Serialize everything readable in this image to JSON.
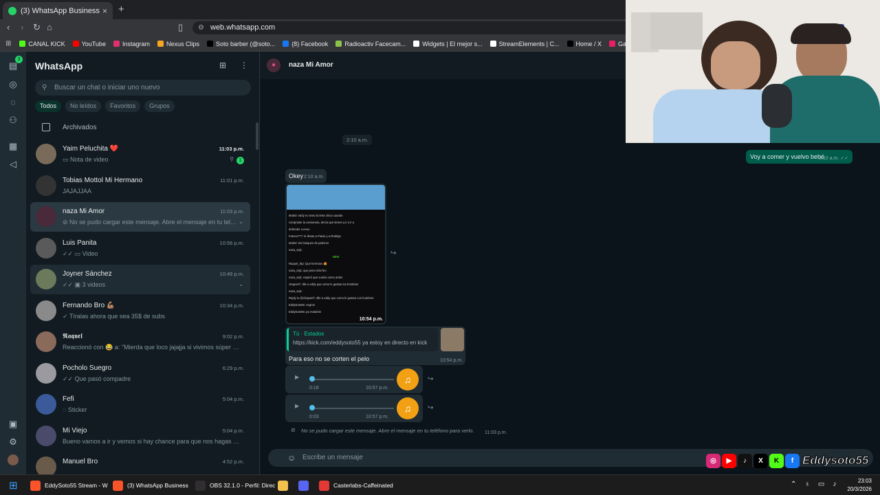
{
  "browser": {
    "tab_title": "(3) WhatsApp Business",
    "tab_close": "×",
    "new_tab": "+",
    "url": "web.whatsapp.com",
    "bookmarks": [
      {
        "label": "CANAL KICK",
        "color": "#53fc18"
      },
      {
        "label": "YouTube",
        "color": "#ff0000"
      },
      {
        "label": "Instagram",
        "color": "#e1306c"
      },
      {
        "label": "Nexus Clips",
        "color": "#f5a623"
      },
      {
        "label": "Soto barber (@soto...",
        "color": "#000000"
      },
      {
        "label": "(8) Facebook",
        "color": "#1877f2"
      },
      {
        "label": "Radioactiv Facecam...",
        "color": "#8bc34a"
      },
      {
        "label": "Widgets | El mejor s...",
        "color": "#ffffff"
      },
      {
        "label": "StreamElements | C...",
        "color": "#ffffff"
      },
      {
        "label": "Home / X",
        "color": "#000000"
      },
      {
        "label": "Gartic Phone - Tele...",
        "color": "#e91e63"
      }
    ]
  },
  "rail": {
    "badge": "3"
  },
  "sidebar": {
    "title": "WhatsApp",
    "search_placeholder": "Buscar un chat o iniciar uno nuevo",
    "filters": [
      "Todos",
      "No leídos",
      "Favoritos",
      "Grupos"
    ],
    "archived_label": "Archivados",
    "chats": [
      {
        "name": "Yaim Peluchita ❤️",
        "time": "11:03 p.m.",
        "preview": "▭ Nota de video",
        "unread": "1",
        "avatar": "#7a6a5a"
      },
      {
        "name": "Tobias Mottol Mi Hermano",
        "time": "11:01 p.m.",
        "preview": "JAJAJJAA",
        "avatar": "#333333"
      },
      {
        "name": "naza Mi Amor",
        "time": "11:03 p.m.",
        "preview": "⊘ No se pudo cargar este mensaje. Abre el mensaje en tu teléfono para verlo.",
        "avatar": "#4a2a3a"
      },
      {
        "name": "Luis Panita",
        "time": "10:56 p.m.",
        "preview": "✓✓ ▭ Video",
        "avatar": "#5a5a5a"
      },
      {
        "name": "Joyner Sánchez",
        "time": "10:49 p.m.",
        "preview": "✓✓ ▣ 3 videos",
        "avatar": "#6a7a5a"
      },
      {
        "name": "Fernando Bro 💪🏽",
        "time": "10:34 p.m.",
        "preview": "✓ Tíralas ahora que sea 35$ de subs",
        "avatar": "#8a8a8a"
      },
      {
        "name": "𝕽𝖆𝖖𝖚𝖊𝖑",
        "time": "9:02 p.m.",
        "preview": "Reaccionó con 😂 a: \"Mierda que loco jajajja si vivimos súper cerca\"",
        "avatar": "#8a6a5a"
      },
      {
        "name": "Pocholo Suegro",
        "time": "6:29 p.m.",
        "preview": "✓✓ Que pasó compadre",
        "avatar": "#9a9aa0"
      },
      {
        "name": "Fefi",
        "time": "5:04 p.m.",
        "preview": "◌ Sticker",
        "avatar": "#3a5a9a"
      },
      {
        "name": "Mi Viejo",
        "time": "5:04 p.m.",
        "preview": "Bueno vamos a ir y vemos si hay chance para que nos hagas el favor",
        "avatar": "#4a4a6a"
      },
      {
        "name": "Manuel Bro",
        "time": "4:52 p.m.",
        "preview": "",
        "avatar": "#6a5a4a"
      }
    ]
  },
  "chat": {
    "contact_name": "naza Mi Amor",
    "day_pill": "2:10 a.m.",
    "outgoing": {
      "text": "Voy a comer y vuelvo bebé",
      "time": "2:10 a.m. ✓✓"
    },
    "okey": {
      "text": "Okey",
      "time": "2:10 a.m."
    },
    "image_time": "10:54 p.m.",
    "stream_chat_lines": [
      "Mottol: eddy no texto la letra chica cuando",
      "compraste la camioneta, decía que tienes q ir a ir a",
      "defender a eeuu",
      "Famex777: te llevas a Flavio y a Rodrigo",
      "Mottol: los bosques de palermo",
      "naza_ssj1:",
      "NEW",
      "Raquel_rbp: Que hermoso 😍",
      "naza_ssj1: que pena más feo",
      "naza_ssj1: esperó que vuelva como antes",
      "chapoel7: dile a eddy que como le gustan los hombres",
      "naza_ssj1:",
      "Reply to @chapoel7: dile a eddy que como le gustan Los hombres",
      "EddySoto55: negros",
      "EddySoto55: pa matarlos"
    ],
    "reply_card": {
      "header": "Tú · Estados",
      "quote": "https://kick.com/eddysoto55 ya estoy en directo en kick",
      "text": "Para eso no se corten el pelo",
      "time": "10:54 p.m."
    },
    "audio": [
      {
        "elapsed": "0:18",
        "time": "10:57 p.m."
      },
      {
        "elapsed": "0:03",
        "time": "10:57 p.m."
      }
    ],
    "failed": {
      "text": "No se pudo cargar este mensaje. Abre el mensaje en tu teléfono para verlo.",
      "time": "11:03 p.m."
    },
    "composer_placeholder": "Escribe un mensaje"
  },
  "overlay": {
    "handle": "Eddysoto55"
  },
  "taskbar": {
    "items": [
      {
        "label": "EddySoto55 Stream - W",
        "color": "#fb542b"
      },
      {
        "label": "(3) WhatsApp Business",
        "color": "#fb542b"
      },
      {
        "label": "OBS 32.1.0 - Perfil: Direc",
        "color": "#302e31"
      },
      {
        "label": "",
        "color": "#f2c14e"
      },
      {
        "label": "",
        "color": "#5865f2"
      },
      {
        "label": "Casterlabs-Caffeinated",
        "color": "#e53935"
      }
    ],
    "time": "23:03",
    "date": "20/3/2026"
  }
}
